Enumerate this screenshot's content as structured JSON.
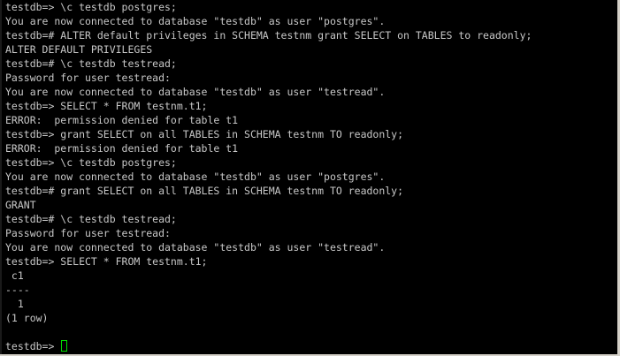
{
  "terminal": {
    "lines": [
      "testdb=> \\c testdb postgres;",
      "You are now connected to database \"testdb\" as user \"postgres\".",
      "testdb=# ALTER default privileges in SCHEMA testnm grant SELECT on TABLES to readonly;",
      "ALTER DEFAULT PRIVILEGES",
      "testdb=# \\c testdb testread;",
      "Password for user testread:",
      "You are now connected to database \"testdb\" as user \"testread\".",
      "testdb=> SELECT * FROM testnm.t1;",
      "ERROR:  permission denied for table t1",
      "testdb=> grant SELECT on all TABLES in SCHEMA testnm TO readonly;",
      "ERROR:  permission denied for table t1",
      "testdb=> \\c testdb postgres;",
      "You are now connected to database \"testdb\" as user \"postgres\".",
      "testdb=# grant SELECT on all TABLES in SCHEMA testnm TO readonly;",
      "GRANT",
      "testdb=# \\c testdb testread;",
      "Password for user testread:",
      "You are now connected to database \"testdb\" as user \"testread\".",
      "testdb=> SELECT * FROM testnm.t1;",
      " c1",
      "----",
      "  1",
      "(1 row)",
      ""
    ],
    "prompt": "testdb=> ",
    "colors": {
      "background": "#000000",
      "text": "#c8c8c8",
      "cursor": "#00e000"
    }
  }
}
